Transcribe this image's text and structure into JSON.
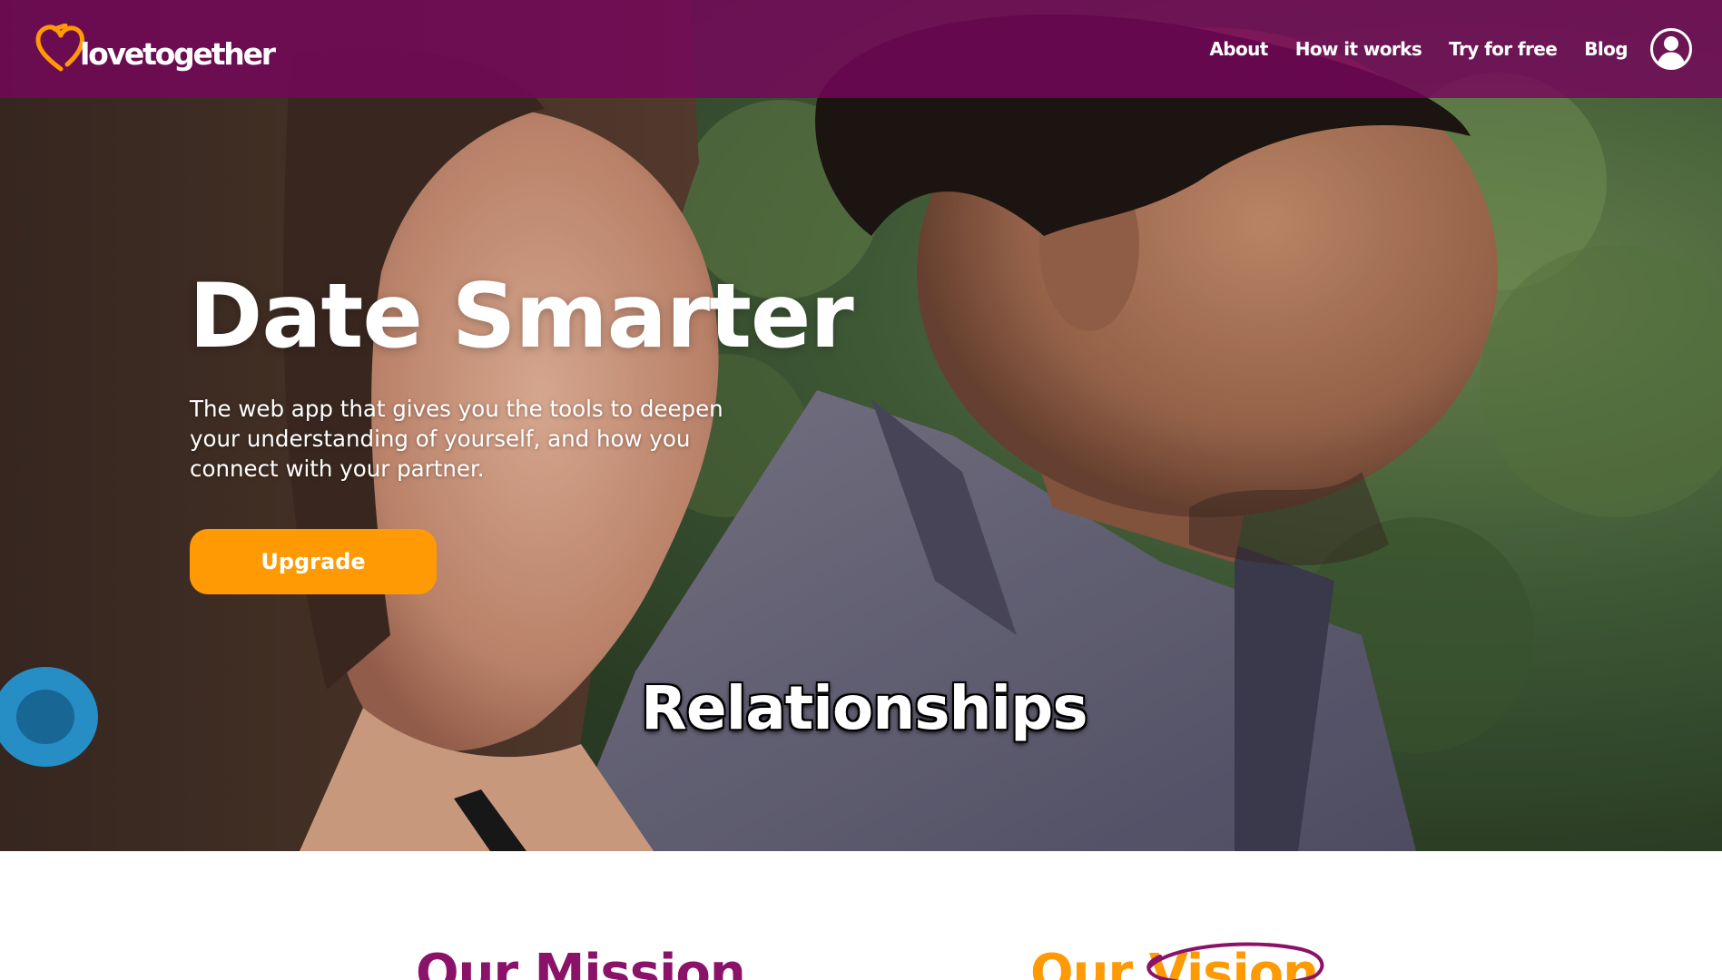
{
  "header": {
    "logo_text": "lovetogether",
    "nav": {
      "about": "About",
      "how_it_works": "How it works",
      "try_for_free": "Try for free",
      "blog": "Blog"
    }
  },
  "hero": {
    "title": "Date Smarter",
    "description": "The web app that gives you the tools to deepen your understanding of yourself, and how you connect with your partner.",
    "cta_label": "Upgrade",
    "video_caption": "Relationships"
  },
  "sections": {
    "mission_heading": "Our Mission",
    "vision_prefix": "Our",
    "vision_word": "Vision"
  },
  "colors": {
    "header_bg": "#76065c",
    "accent_orange": "#ff9a05",
    "brand_purple": "#8a1369"
  },
  "icons": {
    "logo": "heart-logo-icon",
    "user": "user-account-icon"
  }
}
